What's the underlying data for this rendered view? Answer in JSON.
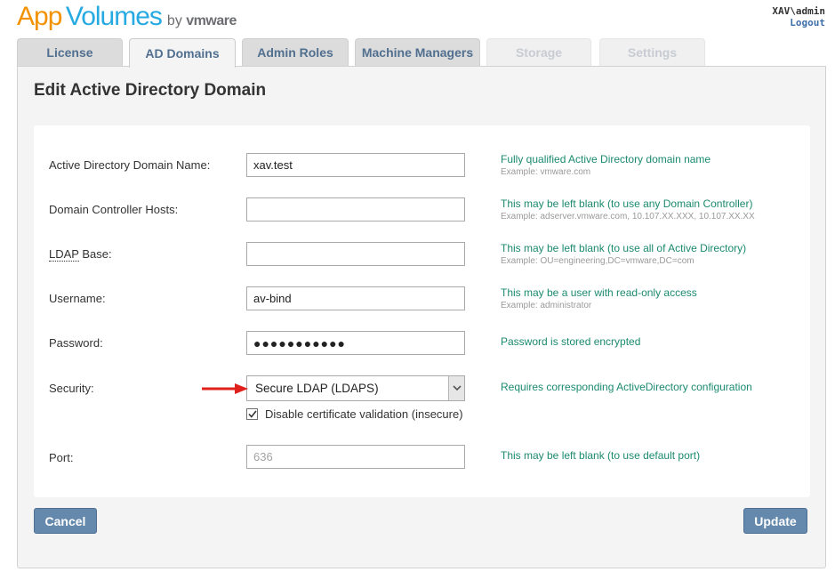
{
  "header": {
    "logo": {
      "app": "App",
      "volumes": "Volumes",
      "by": "by",
      "vmware": "vmware"
    },
    "user": "XAV\\admin",
    "logout": "Logout"
  },
  "tabs": [
    {
      "label": "License",
      "state": "normal"
    },
    {
      "label": "AD Domains",
      "state": "active"
    },
    {
      "label": "Admin Roles",
      "state": "normal"
    },
    {
      "label": "Machine Managers",
      "state": "normal"
    },
    {
      "label": "Storage",
      "state": "disabled"
    },
    {
      "label": "Settings",
      "state": "disabled"
    }
  ],
  "page_title": "Edit Active Directory Domain",
  "form": {
    "domain_name": {
      "label": "Active Directory Domain Name:",
      "value": "xav.test",
      "hint": "Fully qualified Active Directory domain name",
      "example": "Example: vmware.com"
    },
    "dc_hosts": {
      "label": "Domain Controller Hosts:",
      "value": "",
      "hint": "This may be left blank (to use any Domain Controller)",
      "example": "Example: adserver.vmware.com, 10.107.XX.XXX, 10.107.XX.XX"
    },
    "ldap_base": {
      "label_abbr": "LDAP",
      "label_rest": " Base:",
      "value": "",
      "hint": "This may be left blank (to use all of Active Directory)",
      "example": "Example: OU=engineering,DC=vmware,DC=com"
    },
    "username": {
      "label": "Username:",
      "value": "av-bind",
      "hint": "This may be a user with read-only access",
      "example": "Example: administrator"
    },
    "password": {
      "label": "Password:",
      "value": "●●●●●●●●●●●",
      "hint": "Password is stored encrypted"
    },
    "security": {
      "label": "Security:",
      "selected": "Secure LDAP (LDAPS)",
      "hint": "Requires corresponding ActiveDirectory configuration",
      "checkbox_label": "Disable certificate validation (insecure)",
      "checkbox_checked": true
    },
    "port": {
      "label": "Port:",
      "placeholder": "636",
      "hint": "This may be left blank (to use default port)"
    }
  },
  "buttons": {
    "cancel": "Cancel",
    "update": "Update"
  },
  "colors": {
    "tab_text": "#516f8f",
    "hint_text": "#1b8a6f",
    "button_bg": "#6589ad",
    "annotation_arrow": "#e0201b",
    "logo_orange": "#f39200",
    "logo_blue": "#27aae1"
  },
  "icons": {
    "select_toggle": "chevron-down-icon",
    "checkbox": "checkmark-icon",
    "annotation": "red-arrow-annotation"
  }
}
